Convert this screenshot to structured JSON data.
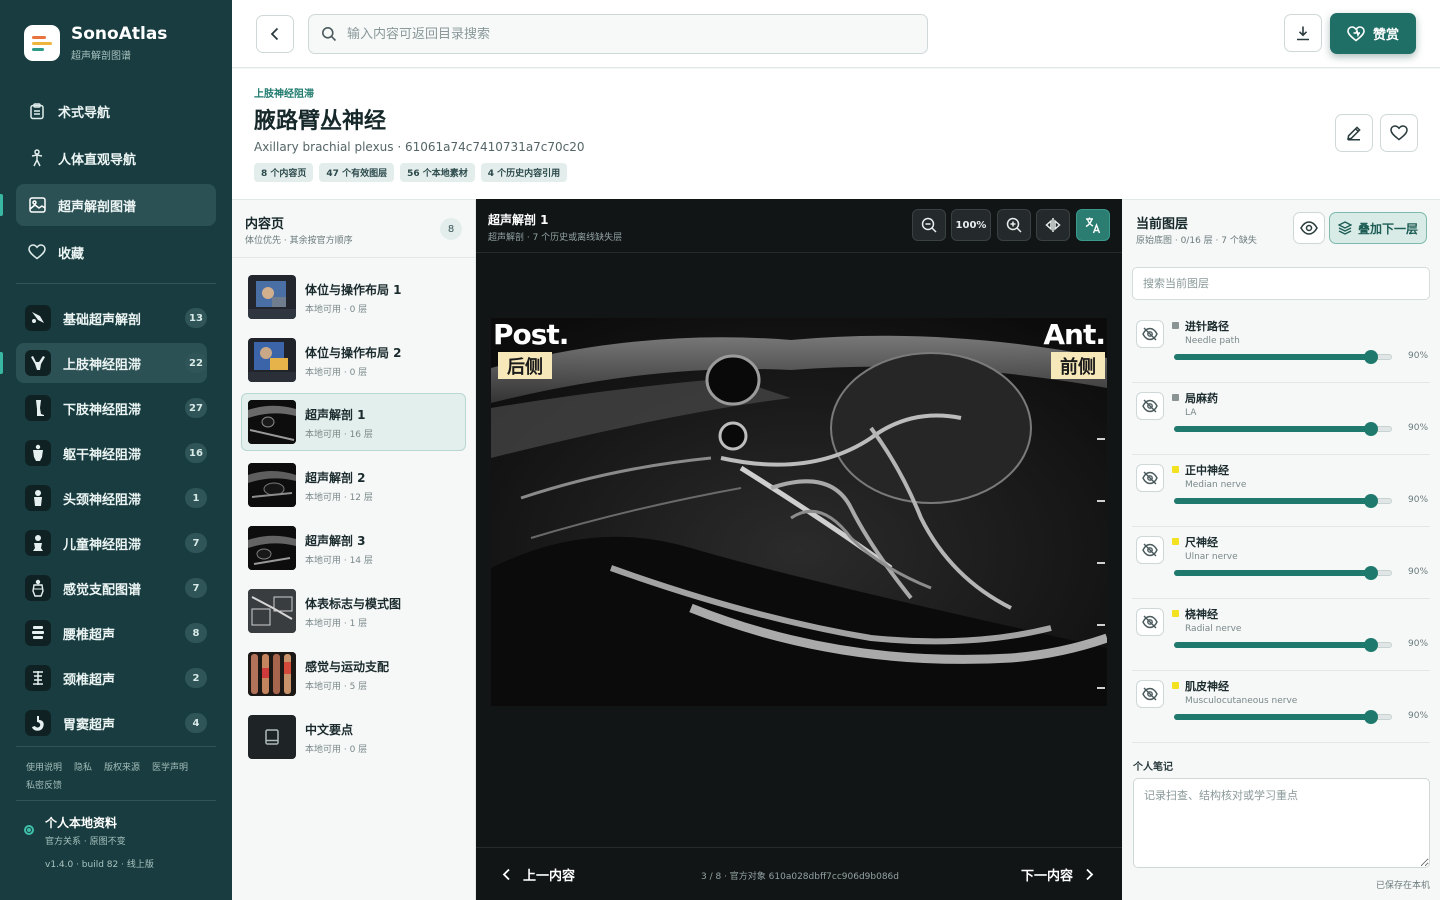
{
  "brand": {
    "name": "SonoAtlas",
    "subtitle": "超声解剖图谱"
  },
  "nav": [
    {
      "label": "术式导航",
      "icon": "clipboard-icon"
    },
    {
      "label": "人体直观导航",
      "icon": "body-icon"
    },
    {
      "label": "超声解剖图谱",
      "icon": "image-icon",
      "active": true
    },
    {
      "label": "收藏",
      "icon": "heart-icon"
    }
  ],
  "categories": [
    {
      "label": "基础超声解剖",
      "count": "13"
    },
    {
      "label": "上肢神经阻滞",
      "count": "22",
      "active": true
    },
    {
      "label": "下肢神经阻滞",
      "count": "27"
    },
    {
      "label": "躯干神经阻滞",
      "count": "16"
    },
    {
      "label": "头颈神经阻滞",
      "count": "1"
    },
    {
      "label": "儿童神经阻滞",
      "count": "7"
    },
    {
      "label": "感觉支配图谱",
      "count": "7"
    },
    {
      "label": "腰椎超声",
      "count": "8"
    },
    {
      "label": "颈椎超声",
      "count": "2"
    },
    {
      "label": "胃窦超声",
      "count": "4"
    }
  ],
  "footer_links": [
    "使用说明",
    "隐私",
    "版权来源",
    "医学声明",
    "私密反馈"
  ],
  "profile": {
    "name": "个人本地资料",
    "sub": "官方关系 · 原图不变",
    "version": "v1.4.0 · build 82 · 线上版"
  },
  "topbar": {
    "search_placeholder": "输入内容可返回目录搜索",
    "donate_label": "赞赏"
  },
  "page": {
    "breadcrumb": "上肢神经阻滞",
    "title": "腋路臂丛神经",
    "subtitle": "Axillary brachial plexus · 61061a74c7410731a7c70c20",
    "chips": [
      "8 个内容页",
      "47 个有效图层",
      "56 个本地素材",
      "4 个历史内容引用"
    ]
  },
  "content_list": {
    "title": "内容页",
    "subtitle": "体位优先 · 其余按官方顺序",
    "count": "8",
    "items": [
      {
        "name": "体位与操作布局 1",
        "meta": "本地可用 · 0 层",
        "thumb": "photo"
      },
      {
        "name": "体位与操作布局 2",
        "meta": "本地可用 · 0 层",
        "thumb": "photo"
      },
      {
        "name": "超声解剖 1",
        "meta": "本地可用 · 16 层",
        "thumb": "ultrasound",
        "active": true
      },
      {
        "name": "超声解剖 2",
        "meta": "本地可用 · 12 层",
        "thumb": "ultrasound"
      },
      {
        "name": "超声解剖 3",
        "meta": "本地可用 · 14 层",
        "thumb": "ultrasound"
      },
      {
        "name": "体表标志与模式图",
        "meta": "本地可用 · 1 层",
        "thumb": "diagram"
      },
      {
        "name": "感觉与运动支配",
        "meta": "本地可用 · 5 层",
        "thumb": "legs"
      },
      {
        "name": "中文要点",
        "meta": "本地可用 · 0 层",
        "thumb": "book"
      }
    ]
  },
  "viewer": {
    "title": "超声解剖 1",
    "subtitle": "超声解剖 · 7 个历史或离线缺失层",
    "zoom": "100%",
    "label_left_en": "Post.",
    "label_left_zh": "后侧",
    "label_right_en": "Ant.",
    "label_right_zh": "前侧",
    "prev_label": "上一内容",
    "next_label": "下一内容",
    "position": "3 / 8 · 官方对象 610a028dbff7cc906d9b086d"
  },
  "layers": {
    "title": "当前图层",
    "subtitle": "原始底图 · 0/16 层 · 7 个缺失",
    "add_label": "叠加下一层",
    "search_placeholder": "搜索当前图层",
    "items": [
      {
        "name": "进针路径",
        "en": "Needle path",
        "color": "#8a9494",
        "opacity": 0.9,
        "pct": "90%"
      },
      {
        "name": "局麻药",
        "en": "LA",
        "color": "#8a9494",
        "opacity": 0.9,
        "pct": "90%"
      },
      {
        "name": "正中神经",
        "en": "Median nerve",
        "color": "#f2e21f",
        "opacity": 0.9,
        "pct": "90%"
      },
      {
        "name": "尺神经",
        "en": "Ulnar nerve",
        "color": "#f2e21f",
        "opacity": 0.9,
        "pct": "90%"
      },
      {
        "name": "桡神经",
        "en": "Radial nerve",
        "color": "#f2e21f",
        "opacity": 0.9,
        "pct": "90%"
      },
      {
        "name": "肌皮神经",
        "en": "Musculocutaneous nerve",
        "color": "#f2e21f",
        "opacity": 0.9,
        "pct": "90%"
      }
    ],
    "notes_label": "个人笔记",
    "notes_placeholder": "记录扫查、结构核对或学习重点",
    "saved_text": "已保存在本机"
  }
}
